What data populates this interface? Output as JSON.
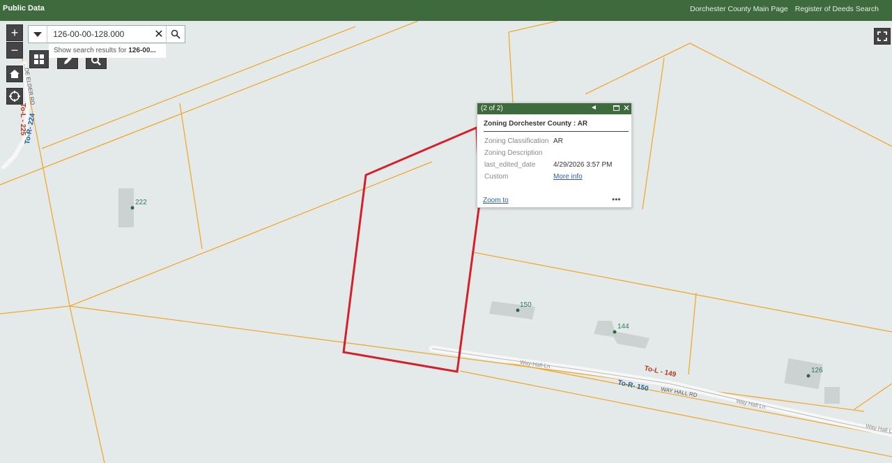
{
  "header": {
    "title": "Public Data",
    "links": [
      "Dorchester County Main Page",
      "Register of Deeds Search"
    ]
  },
  "search": {
    "value": "126-00-00-128.000",
    "suggestion_prefix": "Show search results for ",
    "suggestion_bold": "126-00..."
  },
  "controls": {
    "zoom_in": "+",
    "zoom_out": "−"
  },
  "popup": {
    "counter": "(2 of 2)",
    "title": "Zoning Dorchester County : AR",
    "fields": [
      {
        "key": "Zoning Classification",
        "value": "AR"
      },
      {
        "key": "Zoning Description",
        "value": ""
      },
      {
        "key": "last_edited_date",
        "value": "4/29/2026 3:57 PM"
      },
      {
        "key": "Custom",
        "value": "More info"
      }
    ],
    "zoom_to": "Zoom to",
    "more": "•••"
  },
  "map_labels": {
    "houses": [
      "222",
      "150",
      "144",
      "126"
    ],
    "road_to_l_149": "To-L - 149",
    "road_to_r_150": "To-R- 150",
    "road_to_l_225": "To-L - 225",
    "road_to_r_224": "To-R- 224",
    "road_elder": "...DE ELDER RD",
    "street_way_hall_ln_1": "Way-Hall-Ln",
    "street_way_hall_ln_2": "Way Hall Ln",
    "street_way_hall_ln_3": "Way Hall L",
    "street_way_hall_rd": "WAY HALL RD"
  },
  "colors": {
    "header_bg": "#3d6b3d",
    "parcel_line": "#f0a830",
    "selected_parcel": "#d4202a",
    "map_bg": "#e4eae9"
  }
}
